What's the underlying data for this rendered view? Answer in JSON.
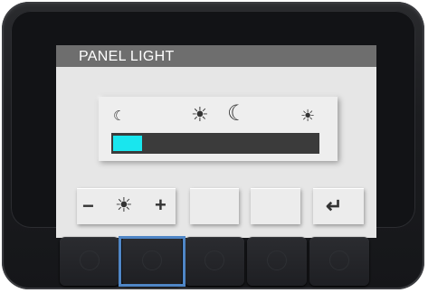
{
  "screen": {
    "title": "PANEL LIGHT"
  },
  "brightness": {
    "level": 0.14,
    "fill_color": "#19e6ee",
    "icons": [
      "moon-icon",
      "sun-icon",
      "moon-icon",
      "sun-icon"
    ]
  },
  "softkeys": {
    "decrease_glyph": "−",
    "brightness_icon": "☀",
    "increase_glyph": "+",
    "back_glyph": "↵"
  },
  "icons": {
    "moon": "☾",
    "sun": "☀"
  },
  "hardware_buttons": {
    "count": 5,
    "selected_index": 1,
    "highlight_color": "#4f86c6"
  }
}
